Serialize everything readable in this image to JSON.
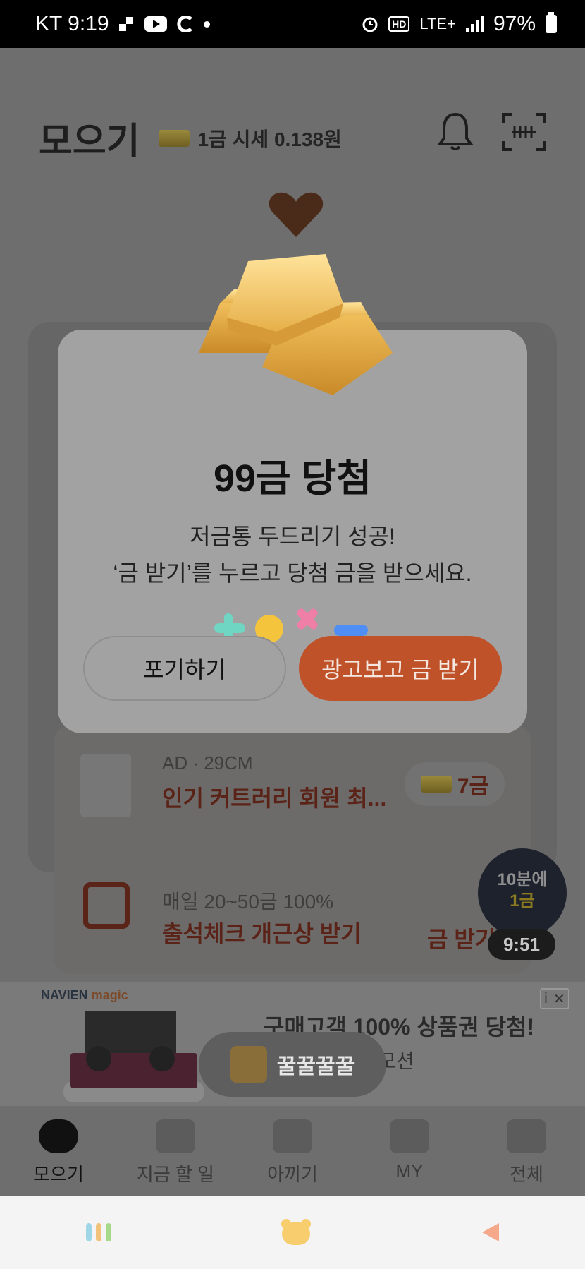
{
  "status_bar": {
    "carrier_time": "KT 9:19",
    "network": "LTE+",
    "battery": "97%"
  },
  "header": {
    "title": "모으기",
    "gold_price": "1금 시세 0.138원"
  },
  "modal": {
    "title": "99금 당첨",
    "line1": "저금통 두드리기 성공!",
    "line2": "‘금 받기’를 누르고 당첨 금을 받으세요.",
    "cancel_label": "포기하기",
    "confirm_label": "광고보고 금 받기"
  },
  "ad_card": {
    "sub": "AD · 29CM",
    "title": "인기 커트러리 회원 최...",
    "reward": "7금"
  },
  "attendance_card": {
    "sub": "매일 20~50금 100%",
    "title": "출석체크 개근상 받기",
    "button": "금 받기"
  },
  "timer": {
    "line1": "10분에",
    "line2": "1금",
    "countdown": "9:51"
  },
  "banner": {
    "brand": "NAVIEN",
    "brand2": "magic",
    "title": "구매고객 100% 상품권 당첨!",
    "subtitle": "런칭기념 프로모션"
  },
  "toast": {
    "text": "꿀꿀꿀꿀"
  },
  "bottom_nav": {
    "items": [
      {
        "label": "모으기"
      },
      {
        "label": "지금 할 일"
      },
      {
        "label": "아끼기"
      },
      {
        "label": "MY"
      },
      {
        "label": "전체"
      }
    ]
  },
  "colors": {
    "accent": "#c0522a",
    "modal_bg": "#a2a2a2",
    "dim_bg": "#6e6e6e"
  }
}
